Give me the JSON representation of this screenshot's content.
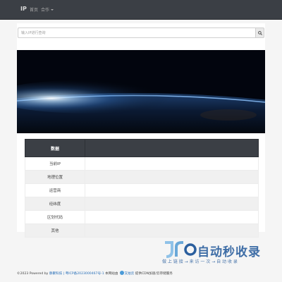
{
  "nav": {
    "brand": "IP",
    "home": "首页",
    "cooperate": "合作"
  },
  "search": {
    "placeholder": "输入IP进行查询"
  },
  "table": {
    "header_label": "数据",
    "header_value": "",
    "rows": [
      {
        "label": "当前IP",
        "value": ""
      },
      {
        "label": "地理位置",
        "value": ""
      },
      {
        "label": "运营商",
        "value": ""
      },
      {
        "label": "经纬度",
        "value": ""
      },
      {
        "label": "区划代码",
        "value": ""
      },
      {
        "label": "其他",
        "value": ""
      }
    ]
  },
  "footer": {
    "copyright": "©2023 Powered by",
    "powered_link": "静聚科技",
    "icp": "| 粤ICP备2023000467号-1",
    "host": "本网站由",
    "cdn_label": "又拍云",
    "cdn_text": "提供CDN加速/云存储服务"
  },
  "watermark": {
    "title": "自动秒收录",
    "subtitle": "做 上 链 接 → 来 访 一 次 → 自 动 收 录"
  },
  "colors": {
    "navbar": "#3b3f45",
    "link": "#2a70b9",
    "watermark": "#2b5f9e"
  }
}
